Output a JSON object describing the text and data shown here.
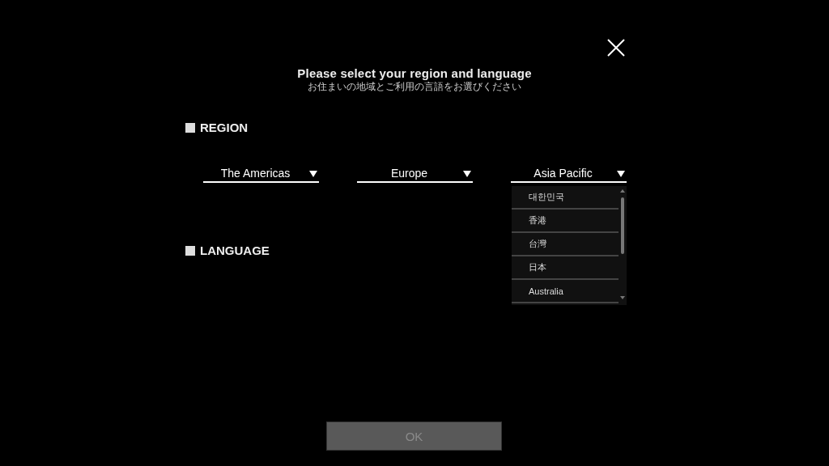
{
  "dialog": {
    "title": "Please select your region and language",
    "subtitle": "お住まいの地域とご利用の言語をお選びください"
  },
  "region": {
    "label": "REGION",
    "dropdowns": [
      {
        "value": "The Americas"
      },
      {
        "value": "Europe"
      },
      {
        "value": "Asia Pacific",
        "options": [
          "대한민국",
          "香港",
          "台灣",
          "日本",
          "Australia"
        ]
      }
    ]
  },
  "language": {
    "label": "LANGUAGE"
  },
  "ok_button": {
    "label": "OK",
    "disabled": true
  }
}
